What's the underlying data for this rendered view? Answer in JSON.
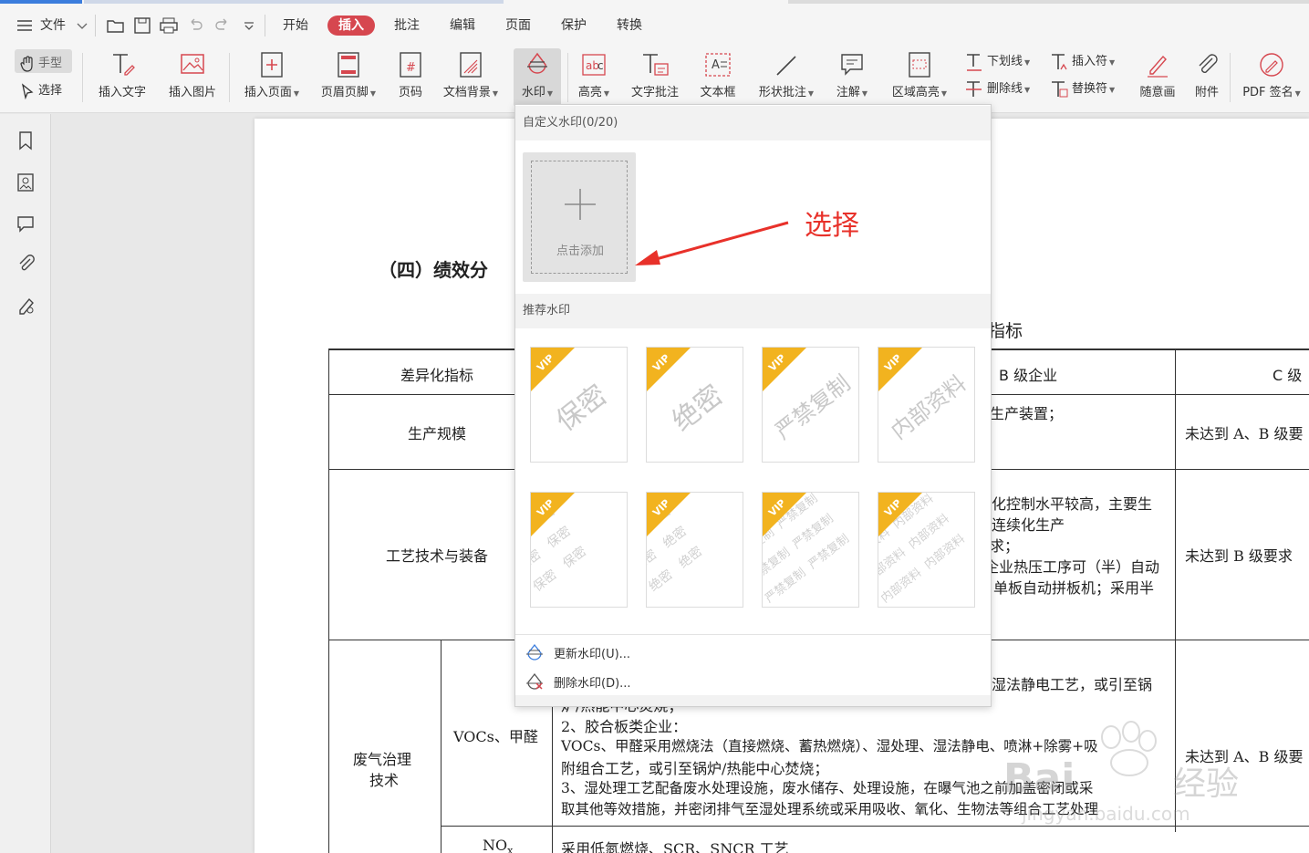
{
  "menubar": {
    "file_label": "文件",
    "tabs": [
      {
        "label": "开始",
        "active": false
      },
      {
        "label": "插入",
        "active": true
      },
      {
        "label": "批注",
        "active": false
      },
      {
        "label": "编辑",
        "active": false
      },
      {
        "label": "页面",
        "active": false
      },
      {
        "label": "保护",
        "active": false
      },
      {
        "label": "转换",
        "active": false
      }
    ]
  },
  "ribbon": {
    "hand_label": "手型",
    "select_label": "选择",
    "insert_text": "插入文字",
    "insert_image": "插入图片",
    "insert_page": "插入页面",
    "header_footer": "页眉页脚",
    "page_number": "页码",
    "doc_background": "文档背景",
    "watermark": "水印",
    "highlight": "高亮",
    "text_comment": "文字批注",
    "text_box": "文本框",
    "shape_comment": "形状批注",
    "annotation": "注解",
    "area_highlight": "区域高亮",
    "underline": "下划线",
    "strikethrough": "删除线",
    "insert_mark": "插入符",
    "replace_mark": "替换符",
    "freehand": "随意画",
    "attachment": "附件",
    "pdf_sign": "PDF 签名"
  },
  "dropdown": {
    "custom_header": "自定义水印(0/20)",
    "add_label": "点击添加",
    "recommend_header": "推荐水印",
    "single_tiles": [
      "保密",
      "绝密",
      "严禁复制",
      "内部资料"
    ],
    "tiled_tiles": [
      "保密",
      "绝密",
      "严禁复制",
      "内部资料"
    ],
    "vip_label": "VIP",
    "update_label": "更新水印(U)...",
    "delete_label": "删除水印(D)..."
  },
  "annotation": {
    "label": "选择"
  },
  "document": {
    "section_title": "（四）绩效分",
    "right_heading": "指标",
    "table_header": [
      "差异化指标",
      "B 级企业",
      "C 级"
    ],
    "row1": {
      "label": "生产规模",
      "b": "生产装置；",
      "c": "未达到 A、B 级要"
    },
    "row2": {
      "label": "工艺技术与装备",
      "b_lines": [
        "化控制水平较高，主要生",
        "连续化生产",
        "求；",
        "企业热压工序可（半）自动",
        "单板自动拼板机；采用半"
      ],
      "c": "未达到 B 级要求"
    },
    "row3": {
      "label_line1": "废气治理",
      "label_line2": "技术",
      "sub": "VOCs、甲醛",
      "b_top": "湿法静电工艺，或引至锅",
      "lines": [
        "炉/热能中心焚烧；",
        "2、胶合板类企业：",
        "VOCs、甲醛采用燃烧法（直接燃烧、蓄热燃烧）、湿处理、湿法静电、喷淋+除雾+吸",
        "附组合工艺，或引至锅炉/热能中心焚烧；",
        "3、湿处理工艺配备废水处理设施，废水储存、处理设施，在曝气池之前加盖密闭或采",
        "取其他等效措施，并密闭排气至湿处理系统或采用吸收、氧化、生物法等组合工艺处理"
      ],
      "c": "未达到 A、B 级要"
    },
    "row4": {
      "sub_main": "NO",
      "sub_script": "x",
      "content": "采用低氮燃烧、SCR、SNCR 工艺"
    }
  },
  "watermark_logo": {
    "text": "Bai",
    "text2": "经验",
    "domain": "jingyan.baidu.com"
  }
}
